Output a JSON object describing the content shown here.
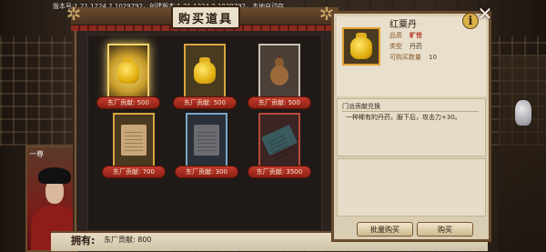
{
  "version_text": "版本号:1.21.1224.2.1029792，创建版本:1.21.1224.2.1029792，本地自动存",
  "portrait": {
    "label": "一尊"
  },
  "shop": {
    "title": "购买道具",
    "items": [
      {
        "name": "golden-jar-glowing",
        "price": "东厂贡献: 500",
        "icon": "jar-icon"
      },
      {
        "name": "golden-jar",
        "price": "东厂贡献: 500",
        "icon": "jar-icon"
      },
      {
        "name": "gourd",
        "price": "东厂贡献: 500",
        "icon": "gourd-icon"
      },
      {
        "name": "book-tan",
        "price": "东厂贡献: 700",
        "icon": "book-icon"
      },
      {
        "name": "book-grey",
        "price": "东厂贡献: 300",
        "icon": "book-icon"
      },
      {
        "name": "book-teal",
        "price": "东厂贡献: 3500",
        "icon": "book-icon"
      }
    ]
  },
  "owned": {
    "label": "拥有:",
    "value": "东厂贡献: 800"
  },
  "detail": {
    "name": "红粟丹",
    "attrs": [
      {
        "key": "品质",
        "value": "旷世"
      },
      {
        "key": "类型",
        "value": "丹药"
      },
      {
        "key": "可购买数量",
        "value": "10"
      }
    ],
    "desc_title": "门派贡献兑换",
    "desc_text": "一种稀有的丹药，服下后，攻击力+30。",
    "batch_buy": "批量购买",
    "buy": "购买"
  },
  "colors": {
    "price_plate": "#c23a2a",
    "quality_red": "#b02a1a",
    "frame": "#7b5a38"
  }
}
